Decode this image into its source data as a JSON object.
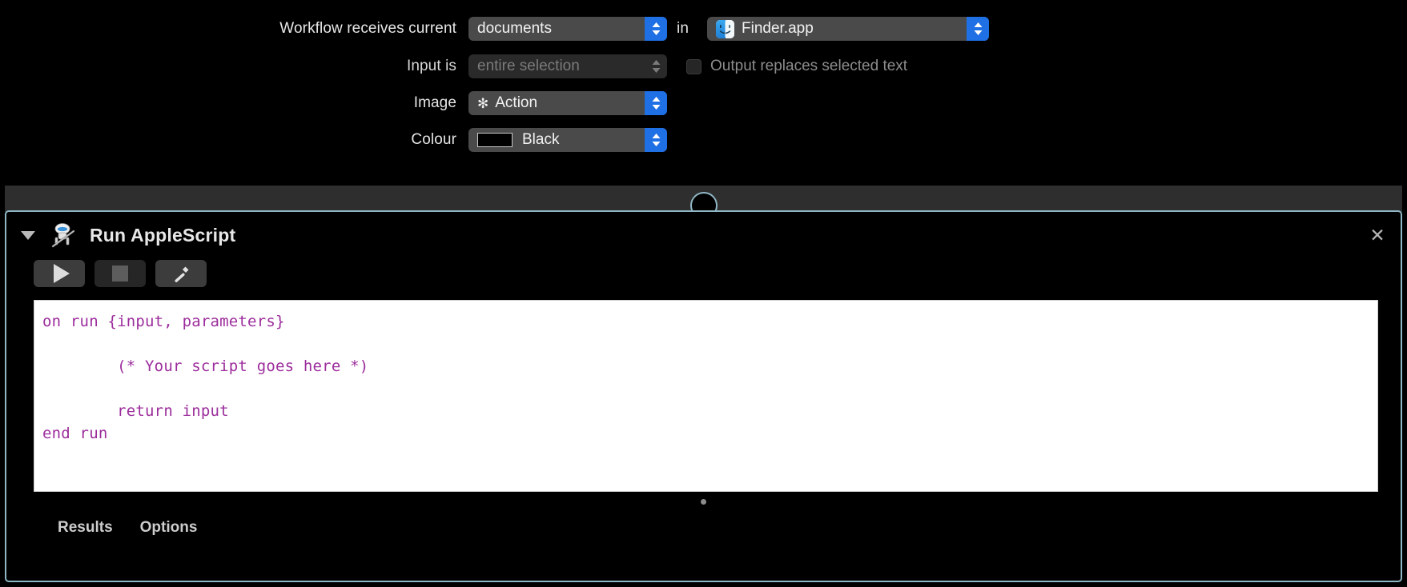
{
  "settings": {
    "rows": [
      {
        "label": "Workflow receives current",
        "value": "documents",
        "disabled": false,
        "suffix_label": "in",
        "app_value": "Finder.app",
        "app_icon": "finder-icon",
        "stepper_icon": "stepper-up-down-icon"
      },
      {
        "label": "Input is",
        "value": "entire selection",
        "disabled": true,
        "checkbox_label": "Output replaces selected text",
        "checkbox_checked": false,
        "stepper_icon": "stepper-up-down-icon"
      },
      {
        "label": "Image",
        "value": "Action",
        "glyph": "✻",
        "glyph_name": "action-gear-icon",
        "disabled": false,
        "stepper_icon": "stepper-up-down-icon"
      },
      {
        "label": "Colour",
        "value": "Black",
        "swatch_color": "#000000",
        "disabled": false,
        "stepper_icon": "stepper-up-down-icon"
      }
    ]
  },
  "action": {
    "title": "Run AppleScript",
    "icon_name": "automator-robot-icon",
    "disclosure_icon": "triangle-down-icon",
    "close_icon": "close-icon",
    "close_glyph": "✕",
    "toolbar": [
      {
        "name": "run-button",
        "icon": "play-icon",
        "enabled": true
      },
      {
        "name": "stop-button",
        "icon": "stop-icon",
        "enabled": false
      },
      {
        "name": "compile-button",
        "icon": "hammer-icon",
        "enabled": true
      }
    ],
    "code": "on run {input, parameters}\n\n\t(* Your script goes here *)\n\n\treturn input\nend run",
    "code_color": "#9c2d9c",
    "tabs": [
      {
        "label": "Results"
      },
      {
        "label": "Options"
      }
    ],
    "selection_color": "#8fb6c4"
  }
}
